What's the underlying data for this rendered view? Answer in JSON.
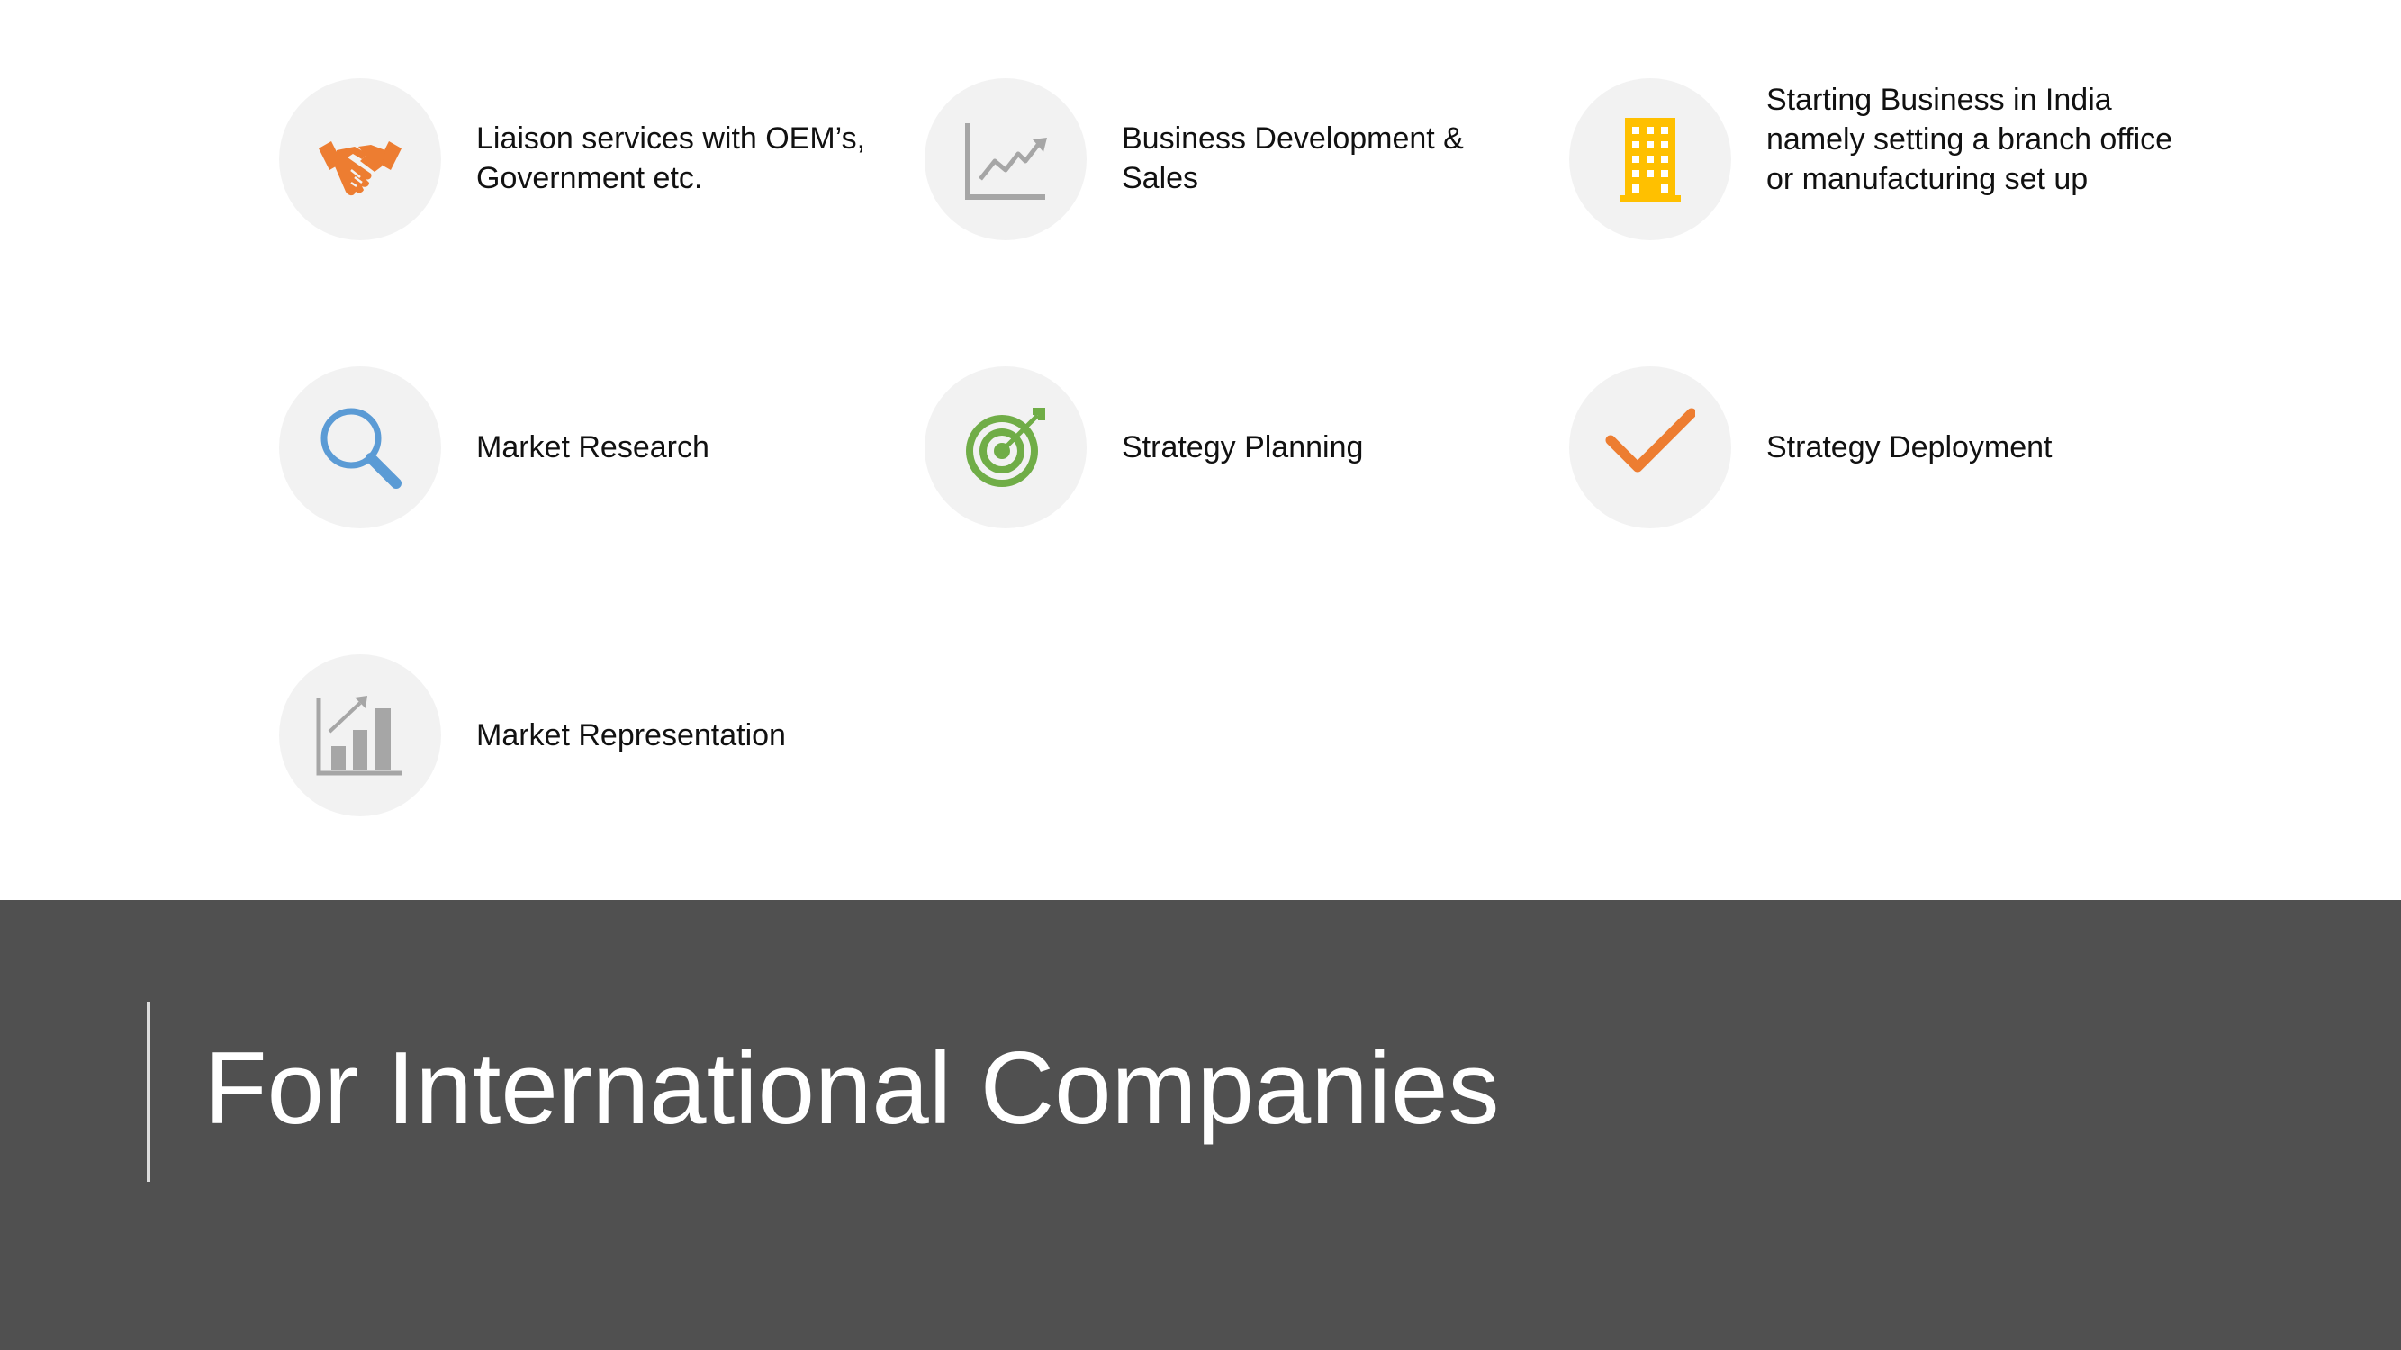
{
  "services": [
    {
      "label": "Liaison services with OEM’s, Government etc.",
      "icon": "handshake-icon",
      "icon_color": "#ED7D31"
    },
    {
      "label": "Business Development & Sales",
      "icon": "line-chart-icon",
      "icon_color": "#A6A6A6"
    },
    {
      "label": "Starting Business in India namely setting a branch office or manufacturing set up",
      "icon": "building-icon",
      "icon_color": "#FFC000"
    },
    {
      "label": "Market Research",
      "icon": "magnifier-icon",
      "icon_color": "#5B9BD5"
    },
    {
      "label": "Strategy Planning",
      "icon": "target-icon",
      "icon_color": "#70AD47"
    },
    {
      "label": "Strategy Deployment",
      "icon": "checkmark-icon",
      "icon_color": "#ED7D31"
    },
    {
      "label": "Market Representation",
      "icon": "bar-chart-icon",
      "icon_color": "#A6A6A6"
    }
  ],
  "section": {
    "title": "For International Companies"
  },
  "colors": {
    "band": "#505050",
    "circle": "#F2F2F2",
    "title": "#FFFFFF"
  }
}
